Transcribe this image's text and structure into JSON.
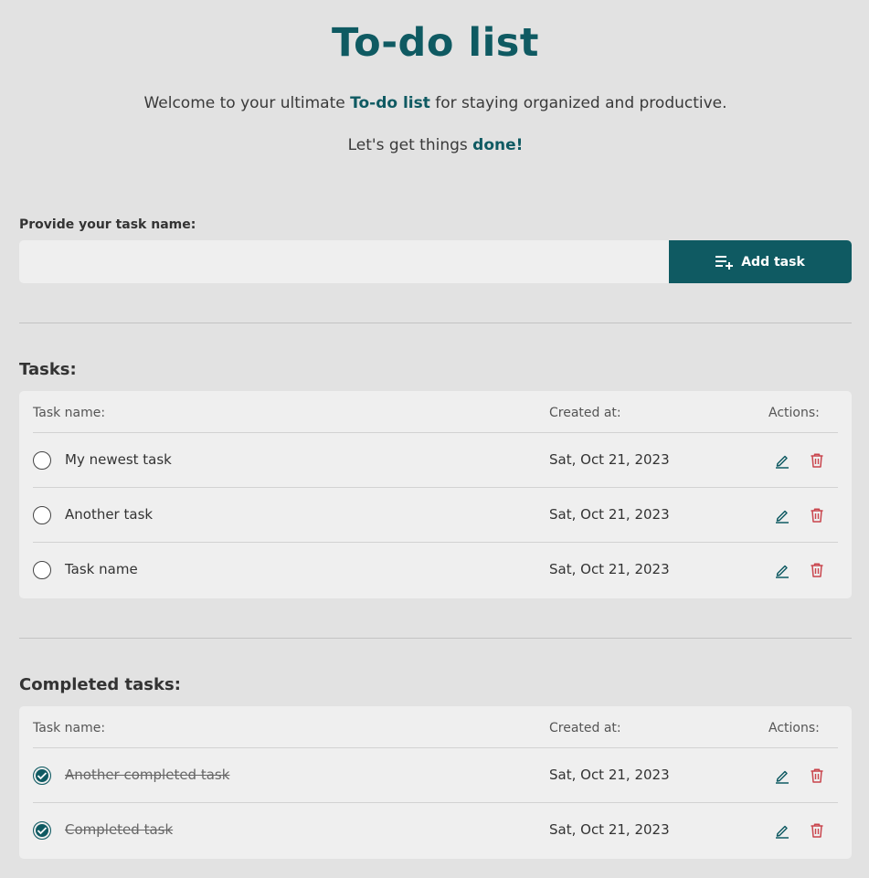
{
  "header": {
    "title": "To-do list",
    "intro_before": "Welcome to your ultimate ",
    "intro_accent": "To-do list",
    "intro_after": " for staying organized and productive.",
    "intro2_before": "Let's get things ",
    "intro2_accent": "done!"
  },
  "form": {
    "label": "Provide your task name:",
    "input_value": "",
    "add_button_label": "Add task"
  },
  "tasks": {
    "title": "Tasks:",
    "columns": {
      "name": "Task name:",
      "created": "Created at:",
      "actions": "Actions:"
    },
    "items": [
      {
        "name": "My newest task",
        "created": "Sat, Oct 21, 2023"
      },
      {
        "name": "Another task",
        "created": "Sat, Oct 21, 2023"
      },
      {
        "name": "Task name",
        "created": "Sat, Oct 21, 2023"
      }
    ]
  },
  "completed": {
    "title": "Completed tasks:",
    "columns": {
      "name": "Task name:",
      "created": "Created at:",
      "actions": "Actions:"
    },
    "items": [
      {
        "name": "Another completed task",
        "created": "Sat, Oct 21, 2023"
      },
      {
        "name": "Completed task",
        "created": "Sat, Oct 21, 2023"
      }
    ]
  },
  "colors": {
    "accent": "#0f5a62",
    "delete": "#c9444c",
    "background": "#e2e2e2",
    "card": "#efefef"
  },
  "icons": {
    "add": "playlist-add-icon",
    "edit": "pencil-icon",
    "delete": "trash-icon",
    "check": "check-icon"
  }
}
